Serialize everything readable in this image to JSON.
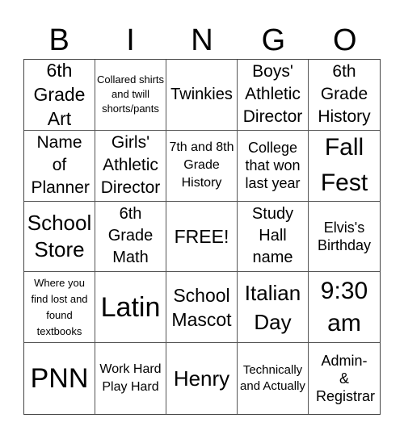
{
  "header": {
    "letters": [
      "B",
      "I",
      "N",
      "G",
      "O"
    ]
  },
  "cells": [
    "6th Grade Art",
    "Collared shirts and twill shorts/pants",
    "Twinkies",
    "Boys' Athletic Director",
    "6th Grade History",
    "Name of Planner",
    "Girls' Athletic Director",
    "7th and 8th Grade History",
    "College that won last year",
    "Fall Fest",
    "School Store",
    "6th Grade Math",
    "FREE!",
    "Study Hall name",
    "Elvis's Birthday",
    "Where you find lost and found textbooks",
    "Latin",
    "School Mascot",
    "Italian Day",
    "9:30 am",
    "PNN",
    "Work Hard Play Hard",
    "Henry",
    "Technically and Actually",
    "Admin- & Registrar"
  ]
}
